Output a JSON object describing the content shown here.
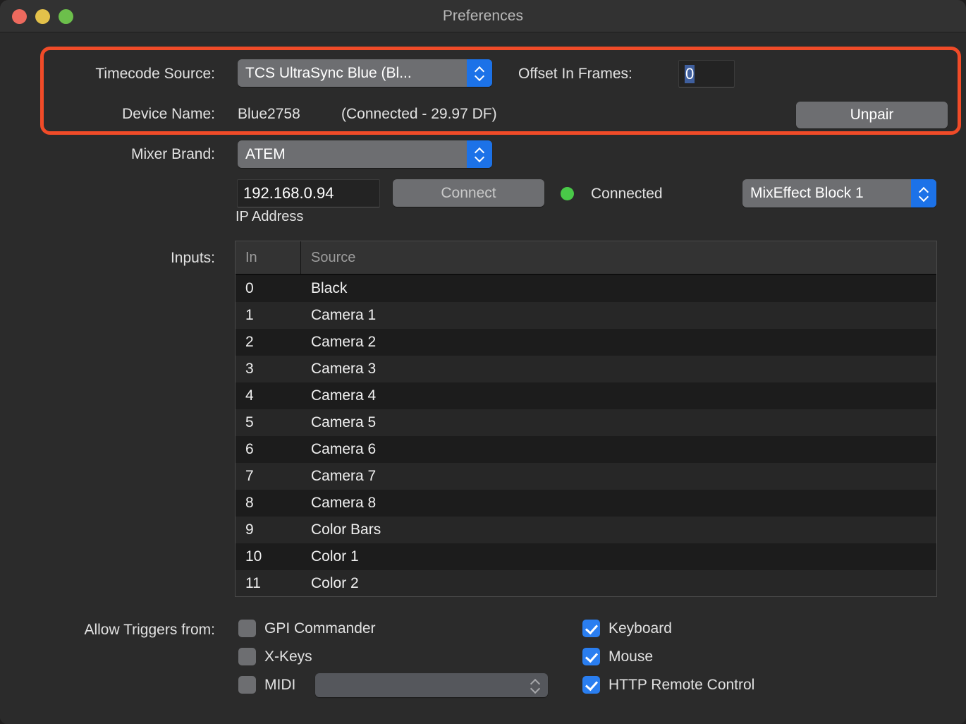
{
  "window": {
    "title": "Preferences",
    "traffic_lights": {
      "close": "close-button",
      "minimize": "minimize-button",
      "maximize": "maximize-button"
    },
    "highlight_color": "#f04b28"
  },
  "timecode": {
    "source_label": "Timecode Source:",
    "source_value": "TCS UltraSync Blue (Bl...",
    "offset_label": "Offset In Frames:",
    "offset_value": "0",
    "device_label": "Device Name:",
    "device_value": "Blue2758",
    "device_status": "(Connected - 29.97 DF)",
    "unpair_label": "Unpair"
  },
  "mixer": {
    "brand_label": "Mixer Brand:",
    "brand_value": "ATEM",
    "ip_value": "192.168.0.94",
    "ip_caption": "IP Address",
    "connect_label": "Connect",
    "connection_status": "Connected",
    "status_color": "#49c948",
    "me_block_value": "MixEffect Block 1"
  },
  "inputs": {
    "label": "Inputs:",
    "columns": [
      "In",
      "Source"
    ],
    "rows": [
      {
        "in": "0",
        "source": "Black"
      },
      {
        "in": "1",
        "source": "Camera 1"
      },
      {
        "in": "2",
        "source": "Camera 2"
      },
      {
        "in": "3",
        "source": "Camera 3"
      },
      {
        "in": "4",
        "source": "Camera 4"
      },
      {
        "in": "5",
        "source": "Camera 5"
      },
      {
        "in": "6",
        "source": "Camera 6"
      },
      {
        "in": "7",
        "source": "Camera 7"
      },
      {
        "in": "8",
        "source": "Camera 8"
      },
      {
        "in": "9",
        "source": "Color Bars"
      },
      {
        "in": "10",
        "source": "Color 1"
      },
      {
        "in": "11",
        "source": "Color 2"
      }
    ]
  },
  "triggers": {
    "label": "Allow Triggers from:",
    "left": [
      {
        "label": "GPI Commander",
        "checked": false
      },
      {
        "label": "X-Keys",
        "checked": false
      },
      {
        "label": "MIDI",
        "checked": false
      }
    ],
    "right": [
      {
        "label": "Keyboard",
        "checked": true
      },
      {
        "label": "Mouse",
        "checked": true
      },
      {
        "label": "HTTP Remote Control",
        "checked": true
      }
    ],
    "midi_device_value": ""
  }
}
